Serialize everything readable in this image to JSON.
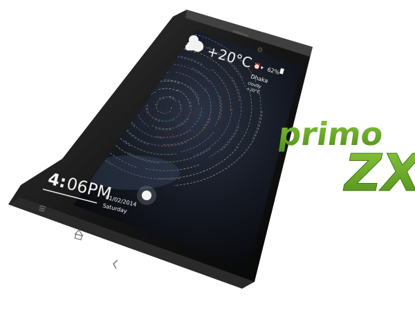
{
  "product": {
    "logo_line1": "primo",
    "logo_line2": "ZX"
  },
  "phone": {
    "weather": {
      "temperature": "+20°C",
      "icon": "cloud-sun-icon"
    },
    "status": {
      "battery": "62%",
      "city": "Dhaka",
      "condition": "cloudy",
      "small_temp": "+20°C"
    },
    "clock": {
      "hour": "4:",
      "minutes": "06PM",
      "date": "01/02/2014",
      "day": "Saturday"
    },
    "nav": {
      "menu_icon": "menu-icon",
      "home_icon": "home-icon",
      "back_icon": "back-icon"
    }
  },
  "colors": {
    "logo_green": "#6aa51f",
    "logo_green_dark": "#3d7a12",
    "phone_body": "#1a1a1a",
    "screen_bg": "#0d0f14"
  }
}
